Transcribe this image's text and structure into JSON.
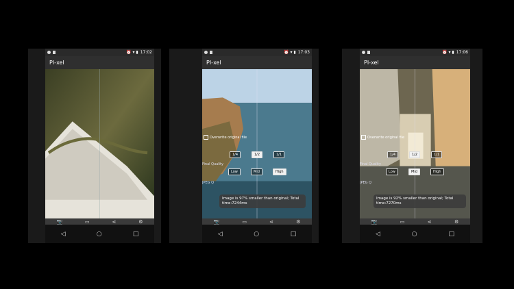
{
  "phones": [
    {
      "status_time": "17:02",
      "app_title": "PI-xel",
      "photo": "lizard-on-stone"
    },
    {
      "status_time": "17:03",
      "app_title": "PI-xel",
      "photo": "coastline",
      "overwrite_label": "Overwrite original file",
      "scale_options": [
        "1/4",
        "1/2",
        "1/1"
      ],
      "scale_selected": "1/2",
      "quality_label": "Final Quality",
      "quality_options": [
        "Low",
        "Mid",
        "High"
      ],
      "quality_selected": "High",
      "jpeg_label": "JPEG Q",
      "toast": "Image is 97% smaller than original; Total time:7244ms"
    },
    {
      "status_time": "17:06",
      "app_title": "PI-xel",
      "photo": "stairway-street",
      "overwrite_label": "Overwrite original file",
      "scale_options": [
        "1/4",
        "1/2",
        "1/1"
      ],
      "scale_selected": "1/2",
      "quality_label": "Final Quality",
      "quality_options": [
        "Low",
        "Mid",
        "High"
      ],
      "quality_selected": "Mid",
      "jpeg_label": "JPEG Q",
      "toast": "Image is 92% smaller than original; Total time:7270ms"
    }
  ],
  "icons": {
    "camera": "camera-icon",
    "gallery": "gallery-icon",
    "folder": "folder-icon",
    "share": "share-icon",
    "settings": "gear-icon",
    "back": "back-icon",
    "home": "home-icon",
    "recents": "recents-icon"
  }
}
